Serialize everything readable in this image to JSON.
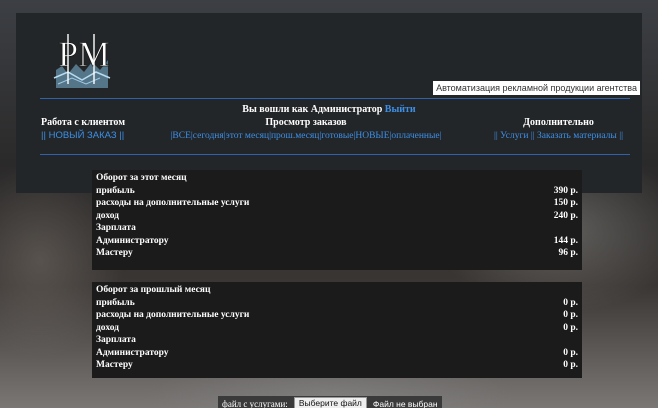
{
  "header": {
    "tagline": "Автоматизация рекламной продукции агентства",
    "logo_text": "PM"
  },
  "login": {
    "text": "Вы вошли как Администратор",
    "logout": "Выйти"
  },
  "nav": {
    "clients": {
      "title": "Работа с клиентом",
      "new_order": "НОВЫЙ ЗАКАЗ"
    },
    "orders": {
      "title": "Просмотр заказов",
      "links": [
        "ВСЕ",
        "сегодня",
        "этот месяц",
        "прош.месяц",
        "готовые",
        "НОВЫЕ",
        "оплаченные"
      ]
    },
    "extra": {
      "title": "Дополнительно",
      "links": [
        "Услуги",
        "Заказать материалы"
      ]
    }
  },
  "current_month": {
    "title": "Оборот за этот месяц",
    "rows": [
      {
        "label": "прибыль",
        "value": "390 р."
      },
      {
        "label": "расходы на дополнительные услуги",
        "value": "150 р."
      },
      {
        "label": "доход",
        "value": "240 р."
      },
      {
        "label": "Зарплата",
        "value": ""
      },
      {
        "label": "Администратору",
        "value": "144 р."
      },
      {
        "label": "Мастеру",
        "value": "96 р."
      }
    ]
  },
  "last_month": {
    "title": "Оборот за прошлый месяц",
    "rows": [
      {
        "label": "прибыль",
        "value": "0 р."
      },
      {
        "label": "расходы на дополнительные услуги",
        "value": "0 р."
      },
      {
        "label": "доход",
        "value": "0 р."
      },
      {
        "label": "Зарплата",
        "value": ""
      },
      {
        "label": "Администратору",
        "value": "0 р."
      },
      {
        "label": "Мастеру",
        "value": "0 р."
      }
    ]
  },
  "upload": {
    "label": "файл с услугами:",
    "button": "Выберите файл",
    "status": "Файл не выбран"
  }
}
